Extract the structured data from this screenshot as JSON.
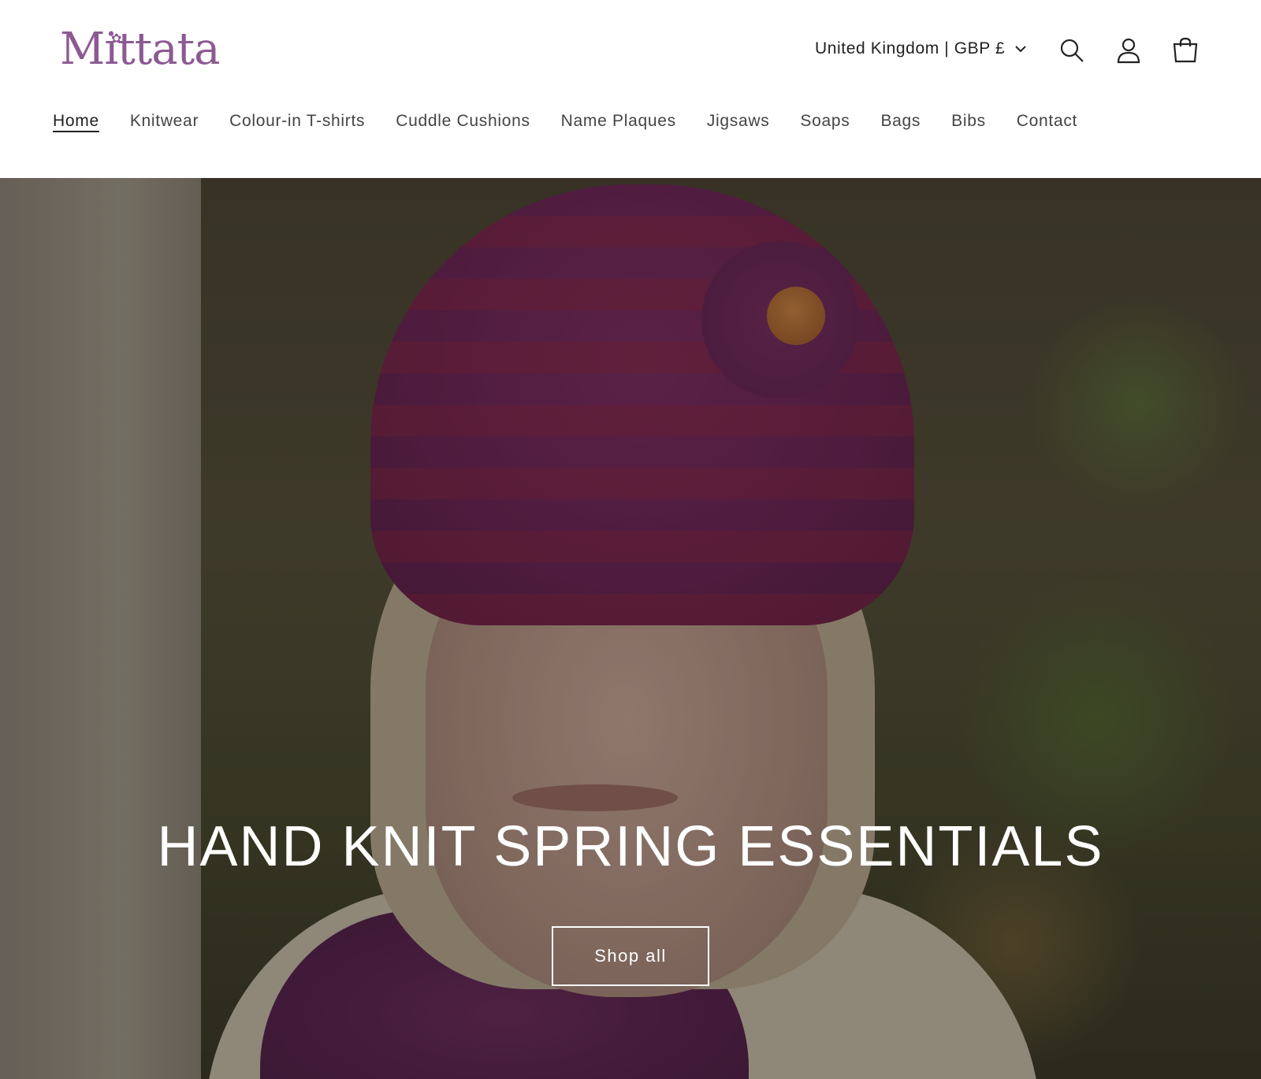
{
  "brand": {
    "name": "Mittata",
    "color": "#8c5a93"
  },
  "header": {
    "country_label": "United Kingdom | GBP £",
    "icons": [
      "search-icon",
      "account-icon",
      "cart-icon"
    ]
  },
  "nav": {
    "items": [
      {
        "label": "Home",
        "active": true
      },
      {
        "label": "Knitwear"
      },
      {
        "label": "Colour-in T-shirts"
      },
      {
        "label": "Cuddle Cushions"
      },
      {
        "label": "Name Plaques"
      },
      {
        "label": "Jigsaws"
      },
      {
        "label": "Soaps"
      },
      {
        "label": "Bags"
      },
      {
        "label": "Bibs"
      },
      {
        "label": "Contact"
      }
    ]
  },
  "hero": {
    "title": "HAND KNIT SPRING ESSENTIALS",
    "cta_label": "Shop all"
  }
}
